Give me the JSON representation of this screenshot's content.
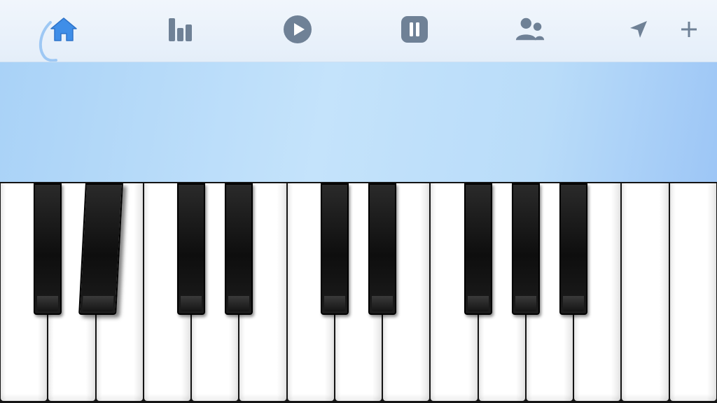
{
  "toolbar": {
    "buttons": [
      {
        "name": "home",
        "icon": "home-icon",
        "active": true
      },
      {
        "name": "chart",
        "icon": "bar-chart-icon",
        "active": false
      },
      {
        "name": "play",
        "icon": "play-icon",
        "active": false
      },
      {
        "name": "pause",
        "icon": "pause-icon",
        "active": false
      },
      {
        "name": "users",
        "icon": "users-icon",
        "active": false
      },
      {
        "name": "navigate",
        "icon": "navigation-arrow-icon",
        "active": false
      },
      {
        "name": "add",
        "icon": "plus-icon",
        "active": false
      }
    ]
  },
  "banner": {
    "text": ""
  },
  "colors": {
    "icon_default": "#6f8196",
    "icon_active": "#3f8ee8",
    "toolbar_bg": "#eaf2fb",
    "banner_bg": "#b9dcf9",
    "white_key": "#ffffff",
    "black_key": "#111111"
  },
  "keyboard": {
    "white_key_count": 15,
    "black_keys": [
      {
        "after_white": 1,
        "pressed": false
      },
      {
        "after_white": 2,
        "pressed": true
      },
      {
        "after_white": 4,
        "pressed": false
      },
      {
        "after_white": 5,
        "pressed": false
      },
      {
        "after_white": 7,
        "pressed": false
      },
      {
        "after_white": 8,
        "pressed": false
      },
      {
        "after_white": 10,
        "pressed": false
      },
      {
        "after_white": 11,
        "pressed": false
      },
      {
        "after_white": 12,
        "pressed": false
      }
    ]
  }
}
